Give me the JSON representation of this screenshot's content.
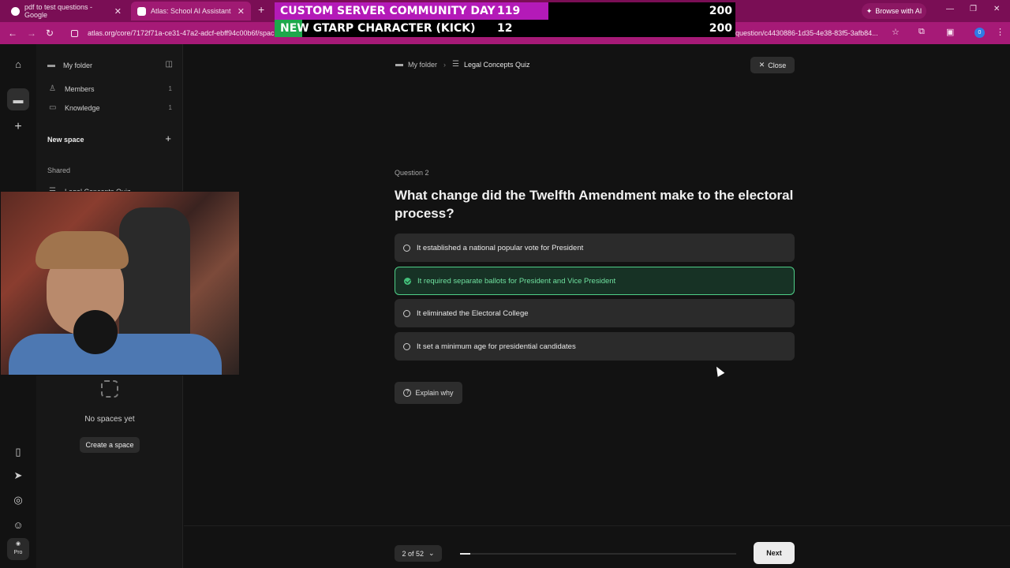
{
  "browser": {
    "tabs": [
      {
        "title": "pdf to test questions - Google"
      },
      {
        "title": "Atlas: School AI Assistant"
      }
    ],
    "browse_ai": "Browse with AI",
    "url_start": "atlas.org/core/7172f71a-ce31-47a2-adcf-ebff94c00b6f/spac",
    "url_end": "question/c4430886-1d35-4e38-83f5-3afb84...",
    "profile": "0"
  },
  "stream_overlay": {
    "rows": [
      {
        "name": "CUSTOM SERVER COMMUNITY DAY",
        "count": "119",
        "goal": "200",
        "progress": 0.595,
        "color": "#b41ab8"
      },
      {
        "name": "NEW GTARP CHARACTER (KICK)",
        "count": "12",
        "goal": "200",
        "progress": 0.06,
        "color": "#1ea84b"
      }
    ]
  },
  "rail": {
    "pro_label": "Pro"
  },
  "sidebar": {
    "folder": "My folder",
    "items": [
      {
        "label": "Members",
        "count": "1"
      },
      {
        "label": "Knowledge",
        "count": "1"
      }
    ],
    "new_space": "New space",
    "shared": "Shared",
    "shared_item": "Legal Concepts Quiz",
    "empty_text": "No spaces yet",
    "create_button": "Create a space"
  },
  "main": {
    "breadcrumb": {
      "folder": "My folder",
      "current": "Legal Concepts Quiz"
    },
    "close_label": "Close",
    "question_label": "Question 2",
    "question_text": "What change did the Twelfth Amendment make to the electoral process?",
    "options": [
      {
        "text": "It established a national popular vote for President",
        "state": "default"
      },
      {
        "text": "It required separate ballots for President and Vice President",
        "state": "correct"
      },
      {
        "text": "It eliminated the Electoral College",
        "state": "default"
      },
      {
        "text": "It set a minimum age for presidential candidates",
        "state": "default"
      }
    ],
    "explain_label": "Explain why",
    "pager_label": "2 of 52",
    "progress_fraction": 0.038,
    "next_label": "Next"
  }
}
